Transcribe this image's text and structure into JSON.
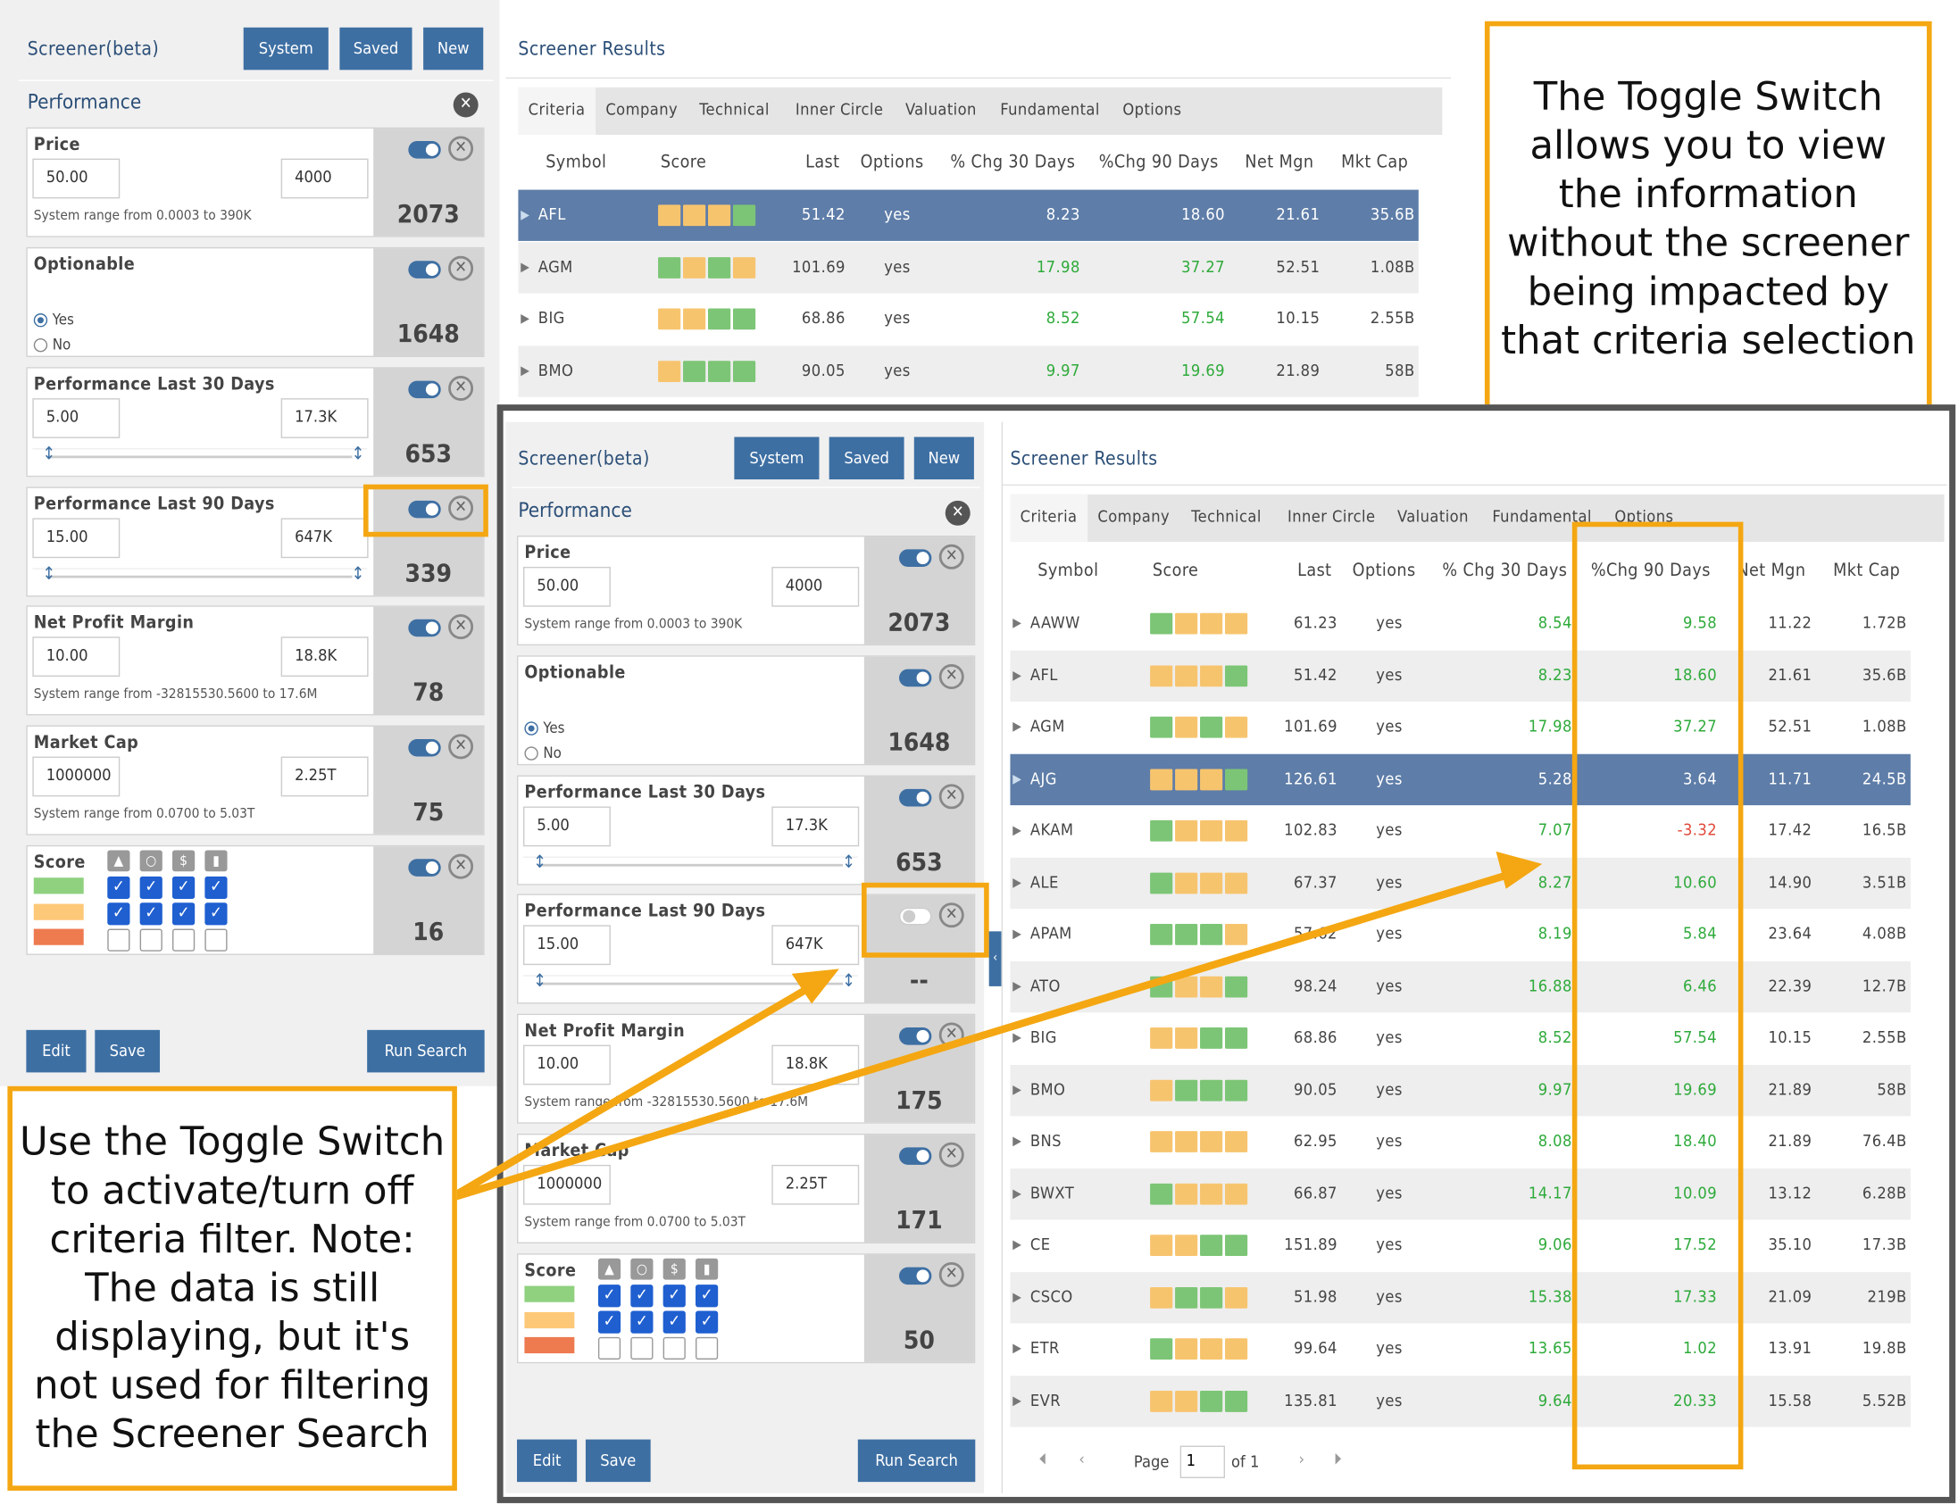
{
  "screener": {
    "title": "Screener(beta)",
    "buttons": {
      "system": "System",
      "saved": "Saved",
      "new": "New"
    },
    "section": "Performance",
    "criteria": {
      "price": {
        "label": "Price",
        "min": "50.00",
        "max": "4000",
        "range": "System range from 0.0003 to 390K",
        "count": "2073"
      },
      "optionable": {
        "label": "Optionable",
        "yes": "Yes",
        "no": "No",
        "count": "1648"
      },
      "perf30": {
        "label": "Performance Last 30 Days",
        "min": "5.00",
        "max": "17.3K",
        "count": "653"
      },
      "perf90": {
        "label": "Performance Last 90 Days",
        "min": "15.00",
        "max": "647K",
        "count_top": "339",
        "count_bottom": "--"
      },
      "npm": {
        "label": "Net Profit Margin",
        "min": "10.00",
        "max": "18.8K",
        "range": "System range from -32815530.5600 to 17.6M",
        "count_top": "78",
        "count_bottom": "175"
      },
      "mktcap": {
        "label": "Market Cap",
        "min": "1000000",
        "max": "2.25T",
        "range": "System range from 0.0700 to 5.03T",
        "count_top": "75",
        "count_bottom": "171"
      },
      "score": {
        "label": "Score",
        "count_top": "16",
        "count_bottom": "50"
      }
    },
    "footer": {
      "edit": "Edit",
      "save": "Save",
      "run": "Run Search"
    }
  },
  "results": {
    "title": "Screener Results",
    "tabs": [
      "Criteria",
      "Company",
      "Technical",
      "Inner Circle",
      "Valuation",
      "Fundamental",
      "Options"
    ],
    "columns": [
      "Symbol",
      "Score",
      "Last",
      "Options",
      "% Chg 30 Days",
      "%Chg 90 Days",
      "Net Mgn",
      "Mkt Cap"
    ],
    "top_rows": [
      {
        "sym": "AFL",
        "last": "51.42",
        "opt": "yes",
        "c30": "8.23",
        "c90": "18.60",
        "mgn": "21.61",
        "cap": "35.6B",
        "sel": true,
        "sc": [
          "#f7c46e",
          "#f7c46e",
          "#f7c46e",
          "#7cc576"
        ]
      },
      {
        "sym": "AGM",
        "last": "101.69",
        "opt": "yes",
        "c30": "17.98",
        "c90": "37.27",
        "mgn": "52.51",
        "cap": "1.08B",
        "sc": [
          "#7cc576",
          "#f7c46e",
          "#7cc576",
          "#f7c46e"
        ]
      },
      {
        "sym": "BIG",
        "last": "68.86",
        "opt": "yes",
        "c30": "8.52",
        "c90": "57.54",
        "mgn": "10.15",
        "cap": "2.55B",
        "sc": [
          "#f7c46e",
          "#f7c46e",
          "#7cc576",
          "#7cc576"
        ]
      },
      {
        "sym": "BMO",
        "last": "90.05",
        "opt": "yes",
        "c30": "9.97",
        "c90": "19.69",
        "mgn": "21.89",
        "cap": "58B",
        "sc": [
          "#f7c46e",
          "#7cc576",
          "#7cc576",
          "#7cc576"
        ]
      }
    ],
    "rows": [
      {
        "sym": "AAWW",
        "last": "61.23",
        "opt": "yes",
        "c30": "8.54",
        "c90": "9.58",
        "mgn": "11.22",
        "cap": "1.72B",
        "sc": [
          "#7cc576",
          "#f7c46e",
          "#f7c46e",
          "#f7c46e"
        ]
      },
      {
        "sym": "AFL",
        "last": "51.42",
        "opt": "yes",
        "c30": "8.23",
        "c90": "18.60",
        "mgn": "21.61",
        "cap": "35.6B",
        "sc": [
          "#f7c46e",
          "#f7c46e",
          "#f7c46e",
          "#7cc576"
        ]
      },
      {
        "sym": "AGM",
        "last": "101.69",
        "opt": "yes",
        "c30": "17.98",
        "c90": "37.27",
        "mgn": "52.51",
        "cap": "1.08B",
        "sc": [
          "#7cc576",
          "#f7c46e",
          "#7cc576",
          "#f7c46e"
        ]
      },
      {
        "sym": "AJG",
        "last": "126.61",
        "opt": "yes",
        "c30": "5.28",
        "c90": "3.64",
        "mgn": "11.71",
        "cap": "24.5B",
        "sel": true,
        "sc": [
          "#f7c46e",
          "#f7c46e",
          "#f7c46e",
          "#7cc576"
        ]
      },
      {
        "sym": "AKAM",
        "last": "102.83",
        "opt": "yes",
        "c30": "7.07",
        "c90": "-3.32",
        "mgn": "17.42",
        "cap": "16.5B",
        "neg": true,
        "sc": [
          "#7cc576",
          "#f7c46e",
          "#f7c46e",
          "#f7c46e"
        ]
      },
      {
        "sym": "ALE",
        "last": "67.37",
        "opt": "yes",
        "c30": "8.27",
        "c90": "10.60",
        "mgn": "14.90",
        "cap": "3.51B",
        "sc": [
          "#7cc576",
          "#f7c46e",
          "#f7c46e",
          "#f7c46e"
        ]
      },
      {
        "sym": "APAM",
        "last": "57.62",
        "opt": "yes",
        "c30": "8.19",
        "c90": "5.84",
        "mgn": "23.64",
        "cap": "4.08B",
        "sc": [
          "#7cc576",
          "#7cc576",
          "#7cc576",
          "#f7c46e"
        ]
      },
      {
        "sym": "ATO",
        "last": "98.24",
        "opt": "yes",
        "c30": "16.88",
        "c90": "6.46",
        "mgn": "22.39",
        "cap": "12.7B",
        "sc": [
          "#7cc576",
          "#f7c46e",
          "#f7c46e",
          "#7cc576"
        ]
      },
      {
        "sym": "BIG",
        "last": "68.86",
        "opt": "yes",
        "c30": "8.52",
        "c90": "57.54",
        "mgn": "10.15",
        "cap": "2.55B",
        "sc": [
          "#f7c46e",
          "#f7c46e",
          "#7cc576",
          "#7cc576"
        ]
      },
      {
        "sym": "BMO",
        "last": "90.05",
        "opt": "yes",
        "c30": "9.97",
        "c90": "19.69",
        "mgn": "21.89",
        "cap": "58B",
        "sc": [
          "#f7c46e",
          "#7cc576",
          "#7cc576",
          "#7cc576"
        ]
      },
      {
        "sym": "BNS",
        "last": "62.95",
        "opt": "yes",
        "c30": "8.08",
        "c90": "18.40",
        "mgn": "21.89",
        "cap": "76.4B",
        "sc": [
          "#f7c46e",
          "#f7c46e",
          "#f7c46e",
          "#f7c46e"
        ]
      },
      {
        "sym": "BWXT",
        "last": "66.87",
        "opt": "yes",
        "c30": "14.17",
        "c90": "10.09",
        "mgn": "13.12",
        "cap": "6.28B",
        "sc": [
          "#7cc576",
          "#f7c46e",
          "#f7c46e",
          "#f7c46e"
        ]
      },
      {
        "sym": "CE",
        "last": "151.89",
        "opt": "yes",
        "c30": "9.06",
        "c90": "17.52",
        "mgn": "35.10",
        "cap": "17.3B",
        "sc": [
          "#f7c46e",
          "#f7c46e",
          "#7cc576",
          "#7cc576"
        ]
      },
      {
        "sym": "CSCO",
        "last": "51.98",
        "opt": "yes",
        "c30": "15.38",
        "c90": "17.33",
        "mgn": "21.09",
        "cap": "219B",
        "sc": [
          "#f7c46e",
          "#7cc576",
          "#7cc576",
          "#f7c46e"
        ]
      },
      {
        "sym": "ETR",
        "last": "99.64",
        "opt": "yes",
        "c30": "13.65",
        "c90": "1.02",
        "mgn": "13.91",
        "cap": "19.8B",
        "sc": [
          "#7cc576",
          "#f7c46e",
          "#f7c46e",
          "#f7c46e"
        ]
      },
      {
        "sym": "EVR",
        "last": "135.81",
        "opt": "yes",
        "c30": "9.64",
        "c90": "20.33",
        "mgn": "15.58",
        "cap": "5.52B",
        "sc": [
          "#f7c46e",
          "#f7c46e",
          "#7cc576",
          "#7cc576"
        ]
      }
    ],
    "pager": {
      "page_label": "Page",
      "page_value": "1",
      "of": "of 1"
    }
  },
  "callouts": {
    "right": "The Toggle Switch allows you to view the information without the screener being impacted by that criteria selection",
    "left": "Use the Toggle Switch to activate/turn off criteria filter. Note:  The data is still displaying, but it's not used for filtering the Screener Search"
  },
  "colors": {
    "accent": "#3d6fa3",
    "highlight": "#f4a712",
    "selected_row": "#5e7da8",
    "positive": "#2eaa3a",
    "negative": "#e04a3a"
  }
}
